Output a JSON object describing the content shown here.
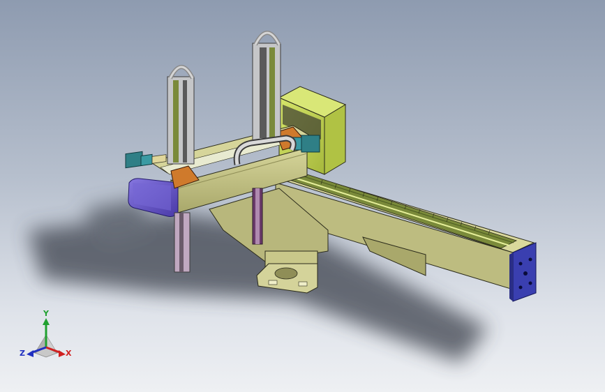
{
  "viewport": {
    "background_top": "#8e9bb0",
    "background_bottom": "#eef0f3"
  },
  "model": {
    "colors": {
      "beam": "#c9c88a",
      "beam_dark": "#8f8e57",
      "motor_housing": "#c4d85a",
      "end_plate": "#3a3fb0",
      "carriage_cap": "#6a5ac8",
      "orange_part": "#d07a2a",
      "teal_motor": "#2f7f86",
      "guide_rail": "#9fb24e",
      "vertical_rail": "#a8a8a8",
      "pink_rod": "#b88ab0",
      "shadow": "#4a4f5a"
    }
  },
  "triad": {
    "x_label": "X",
    "y_label": "Y",
    "z_label": "Z",
    "x_color": "#d02020",
    "y_color": "#20a030",
    "z_color": "#2030c0"
  }
}
